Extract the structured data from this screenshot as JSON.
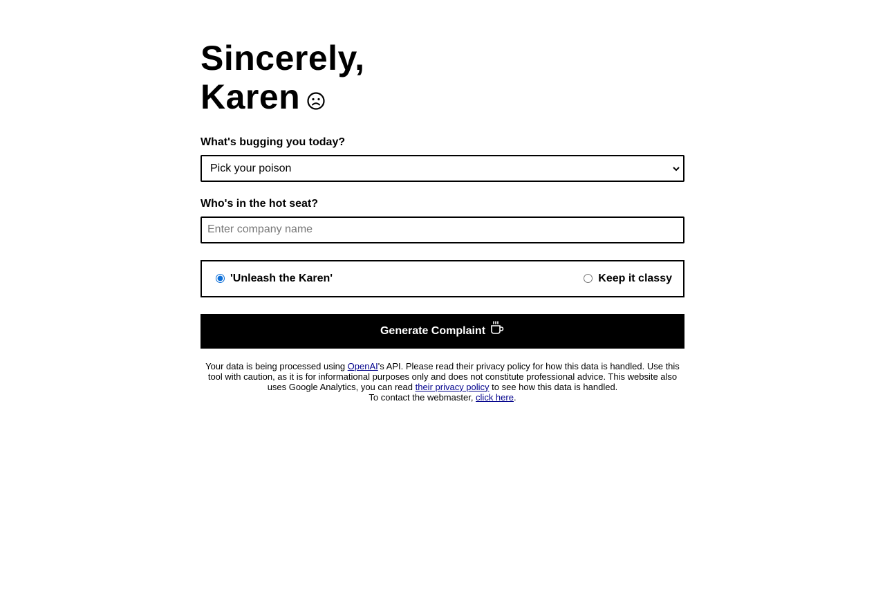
{
  "header": {
    "title_line1": "Sincerely,",
    "title_line2": "Karen",
    "title_icon": "sad-face-icon"
  },
  "form": {
    "issue_label": "What's bugging you today?",
    "issue_select": {
      "selected": "Pick your poison",
      "options": [
        "Pick your poison"
      ]
    },
    "company_label": "Who's in the hot seat?",
    "company_input": {
      "value": "",
      "placeholder": "Enter company name"
    },
    "tone": {
      "options": [
        {
          "label": "'Unleash the Karen'",
          "selected": true
        },
        {
          "label": "Keep it classy",
          "selected": false
        }
      ]
    },
    "submit": {
      "label": "Generate Complaint",
      "icon": "coffee-cup-icon"
    }
  },
  "footer": {
    "part1": "Your data is being processed using ",
    "openai_link": "OpenAI",
    "part2": "'s API. Please read their privacy policy for how this data is handled. Use this tool with caution, as it is for informational purposes only and does not constitute professional advice. This website also uses Google Analytics, you can read ",
    "privacy_link": "their privacy policy",
    "part3": " to see how this data is handled.",
    "contact_prefix": "To contact the webmaster, ",
    "contact_link": "click here",
    "contact_suffix": "."
  },
  "colors": {
    "button_bg": "#000000",
    "link": "#00008b",
    "radio_accent": "#0b6ed8"
  }
}
